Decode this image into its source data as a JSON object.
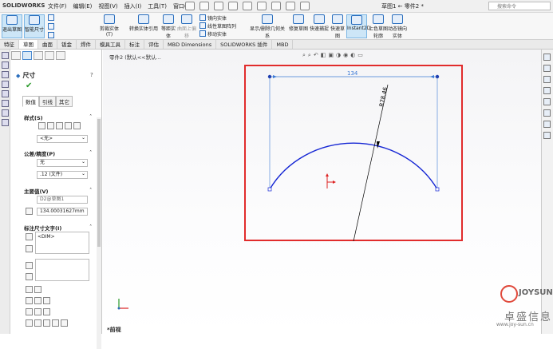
{
  "app": {
    "brand": "SOLIDWORKS",
    "window_title": "草图1 ← 零件2 *",
    "search_placeholder": "搜索命令"
  },
  "menu": [
    "文件(F)",
    "编辑(E)",
    "视图(V)",
    "插入(I)",
    "工具(T)",
    "窗口(W)"
  ],
  "ribbon": {
    "exit_sketch": "退出草图",
    "smart_dim": "智能尺寸",
    "trim": "剪裁实体(T)",
    "convert": "转换实体引用",
    "offset": "等距实体",
    "offset_surface": "曲面上偏移",
    "mirror": "镜向实体",
    "linear_pattern": "线性草图阵列",
    "move": "移动实体",
    "display_delete": "显示/删除几何关系",
    "repair": "修复草图",
    "quick_snaps": "快速草图",
    "rapid_sketch": "快速捕捉",
    "instant2d": "Instant2D",
    "shaded": "上色草图轮廓",
    "dynamic": "动态镜向实体"
  },
  "tabs": [
    "特征",
    "草图",
    "曲面",
    "钣金",
    "焊件",
    "模具工具",
    "标注",
    "评估",
    "MBD Dimensions",
    "SOLIDWORKS 插件",
    "MBD"
  ],
  "active_tab": "草图",
  "panel": {
    "title": "尺寸",
    "help": "?",
    "subtabs": [
      "数值",
      "引线",
      "其它"
    ],
    "style_label": "样式(S)",
    "style_value": "<无>",
    "tolerance_label": "公差/精度(P)",
    "tolerance_value": "无",
    "precision_value": ".12 (文件)",
    "primary_label": "主要值(V)",
    "primary_name": "D2@草图1",
    "primary_value": "134.00031627mm",
    "dimtext_label": "标注尺寸文字(I)",
    "dimtext_value": "<DIM>"
  },
  "canvas": {
    "crumb": "零件2 (默认<<默认...",
    "views_label": "*前视"
  },
  "sketch": {
    "dim_horizontal": "134",
    "dim_radius": "R78.46"
  },
  "watermark": {
    "brand": "JOYSUN",
    "name": "卓盛信息",
    "url": "www.joy-sun.cn"
  }
}
